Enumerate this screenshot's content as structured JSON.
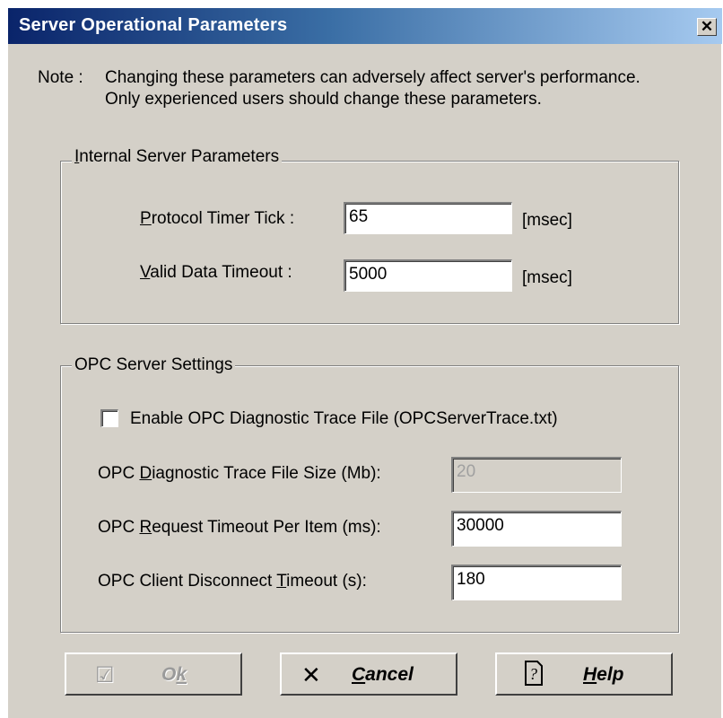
{
  "window": {
    "title": "Server Operational Parameters",
    "close_glyph": "✕"
  },
  "note": {
    "label": "Note :",
    "line1": "Changing these parameters can adversely affect server's performance.",
    "line2": "Only experienced users should change these parameters."
  },
  "internal": {
    "legend_u": "I",
    "legend_rest": "nternal Server Parameters",
    "timer_tick": {
      "label_u": "P",
      "label_rest": "rotocol Timer Tick :",
      "value": "65",
      "unit": "[msec]"
    },
    "valid_timeout": {
      "label_u": "V",
      "label_rest": "alid Data Timeout  :",
      "value": "5000",
      "unit": "[msec]"
    }
  },
  "opc": {
    "legend": "OPC Server Settings",
    "trace_enable": {
      "label": "Enable OPC Diagnostic Trace File (OPCServerTrace.txt)",
      "checked": false
    },
    "trace_size": {
      "label_pre": "OPC ",
      "label_u": "D",
      "label_rest": "iagnostic Trace File Size (Mb):",
      "value": "20",
      "disabled": true
    },
    "request_timeout": {
      "label_pre": "OPC ",
      "label_u": "R",
      "label_rest": "equest Timeout Per Item (ms):",
      "value": "30000"
    },
    "disconnect_timeout": {
      "label_pre": "OPC Client Disconnect ",
      "label_u": "T",
      "label_rest": "imeout (s):",
      "value": "180"
    }
  },
  "buttons": {
    "ok": {
      "label_pre": "O",
      "label_u": "k",
      "icon": "check-icon",
      "disabled": true
    },
    "cancel": {
      "label_u": "C",
      "label_rest": "ancel",
      "icon": "x-icon"
    },
    "help": {
      "label_u": "H",
      "label_rest": "elp",
      "icon": "help-icon"
    }
  }
}
